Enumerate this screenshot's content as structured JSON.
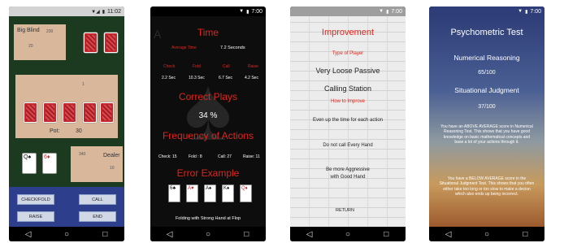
{
  "status_time": "11:02",
  "status_time_alt": "7:00",
  "game": {
    "big_blind_label": "Big Blind",
    "big_blind_amount": "230",
    "big_blind_bet": "20",
    "table_number": "1",
    "pot_label": "Pot:",
    "pot_value": "30",
    "player_chips": "340",
    "dealer_label": "Dealer",
    "dealer_bet": "10",
    "player_cards": [
      "Q♠",
      "6♦"
    ],
    "buttons": {
      "check_fold": "CHECK/FOLD",
      "call": "CALL",
      "raise": "RAISE",
      "end": "END"
    }
  },
  "stats": {
    "time_title": "Time",
    "average_time_label": "Average Time",
    "average_time_value": "7.2 Seconds",
    "action_labels": [
      "Check",
      "Fold",
      "Call",
      "Raise"
    ],
    "action_times": [
      "2.2 Sec",
      "10.3 Sec",
      "6.7 Sec",
      "4.2 Sec"
    ],
    "correct_title": "Correct Plays",
    "correct_value": "34 %",
    "frequency_title": "Frequency of Actions",
    "frequency_items": [
      "Check: 15",
      "Fold : 8",
      "Call: 27",
      "Raise: 11"
    ],
    "error_title": "Error Example",
    "error_cards": [
      "6♣",
      "A♥",
      "A♠",
      "K♠",
      "Q♦"
    ],
    "error_caption": "Folding with Strong Hand at Flop"
  },
  "improve": {
    "title": "Improvement",
    "type_label": "Type of Player",
    "type_value": "Very Loose Passive",
    "type_sub": "Calling Station",
    "how_label": "How to Improve",
    "tips": [
      "Even up the time for each action",
      "Do not call Every Hand",
      "Be more Aggressive",
      "with Good Hand"
    ],
    "return_label": "RETURN"
  },
  "psych": {
    "title": "Psychometric Test",
    "numerical_label": "Numerical Reasoning",
    "numerical_score": "65/100",
    "situational_label": "Situational Judgment",
    "situational_score": "37/100",
    "numerical_text": "You have an ABOVE AVERAGE score in Numerical Reasoning Test. This shows that you have good knowledge on basic mathematical concepts and base a lot of your actions through it.",
    "situational_text": "You have a BELOW AVERAGE score in the Situational Judgment Test. This shows that you often either take too long or too slow to make a decion which also ends up being incorrect."
  },
  "nav_icons": [
    "back-icon",
    "home-icon",
    "recents-icon"
  ],
  "colors": {
    "accent_red": "#e3241b",
    "felt_green": "#1b3a1f",
    "tan": "#d8b79b",
    "button_blue": "#d0d7e6"
  }
}
